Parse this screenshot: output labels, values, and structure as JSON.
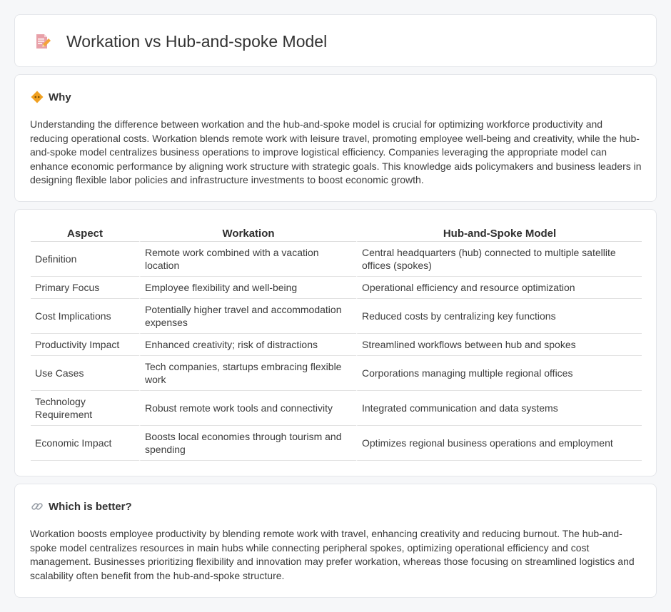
{
  "header": {
    "title": "Workation vs Hub-and-spoke Model",
    "icon": "document-pencil-icon"
  },
  "why": {
    "heading": "Why",
    "icon": "diamond-bullet-icon",
    "text": "Understanding the difference between workation and the hub-and-spoke model is crucial for optimizing workforce productivity and reducing operational costs. Workation blends remote work with leisure travel, promoting employee well-being and creativity, while the hub-and-spoke model centralizes business operations to improve logistical efficiency. Companies leveraging the appropriate model can enhance economic performance by aligning work structure with strategic goals. This knowledge aids policymakers and business leaders in designing flexible labor policies and infrastructure investments to boost economic growth."
  },
  "table": {
    "headers": [
      "Aspect",
      "Workation",
      "Hub-and-Spoke Model"
    ],
    "rows": [
      [
        "Definition",
        "Remote work combined with a vacation location",
        "Central headquarters (hub) connected to multiple satellite offices (spokes)"
      ],
      [
        "Primary Focus",
        "Employee flexibility and well-being",
        "Operational efficiency and resource optimization"
      ],
      [
        "Cost Implications",
        "Potentially higher travel and accommodation expenses",
        "Reduced costs by centralizing key functions"
      ],
      [
        "Productivity Impact",
        "Enhanced creativity; risk of distractions",
        "Streamlined workflows between hub and spokes"
      ],
      [
        "Use Cases",
        "Tech companies, startups embracing flexible work",
        "Corporations managing multiple regional offices"
      ],
      [
        "Technology Requirement",
        "Robust remote work tools and connectivity",
        "Integrated communication and data systems"
      ],
      [
        "Economic Impact",
        "Boosts local economies through tourism and spending",
        "Optimizes regional business operations and employment"
      ]
    ]
  },
  "better": {
    "heading": "Which is better?",
    "icon": "link-icon",
    "text": "Workation boosts employee productivity by blending remote work with travel, enhancing creativity and reducing burnout. The hub-and-spoke model centralizes resources in main hubs while connecting peripheral spokes, optimizing operational efficiency and cost management. Businesses prioritizing flexibility and innovation may prefer workation, whereas those focusing on streamlined logistics and scalability often benefit from the hub-and-spoke structure."
  },
  "colors": {
    "accent_orange": "#f0a020",
    "page_bg": "#f6f7f9"
  }
}
